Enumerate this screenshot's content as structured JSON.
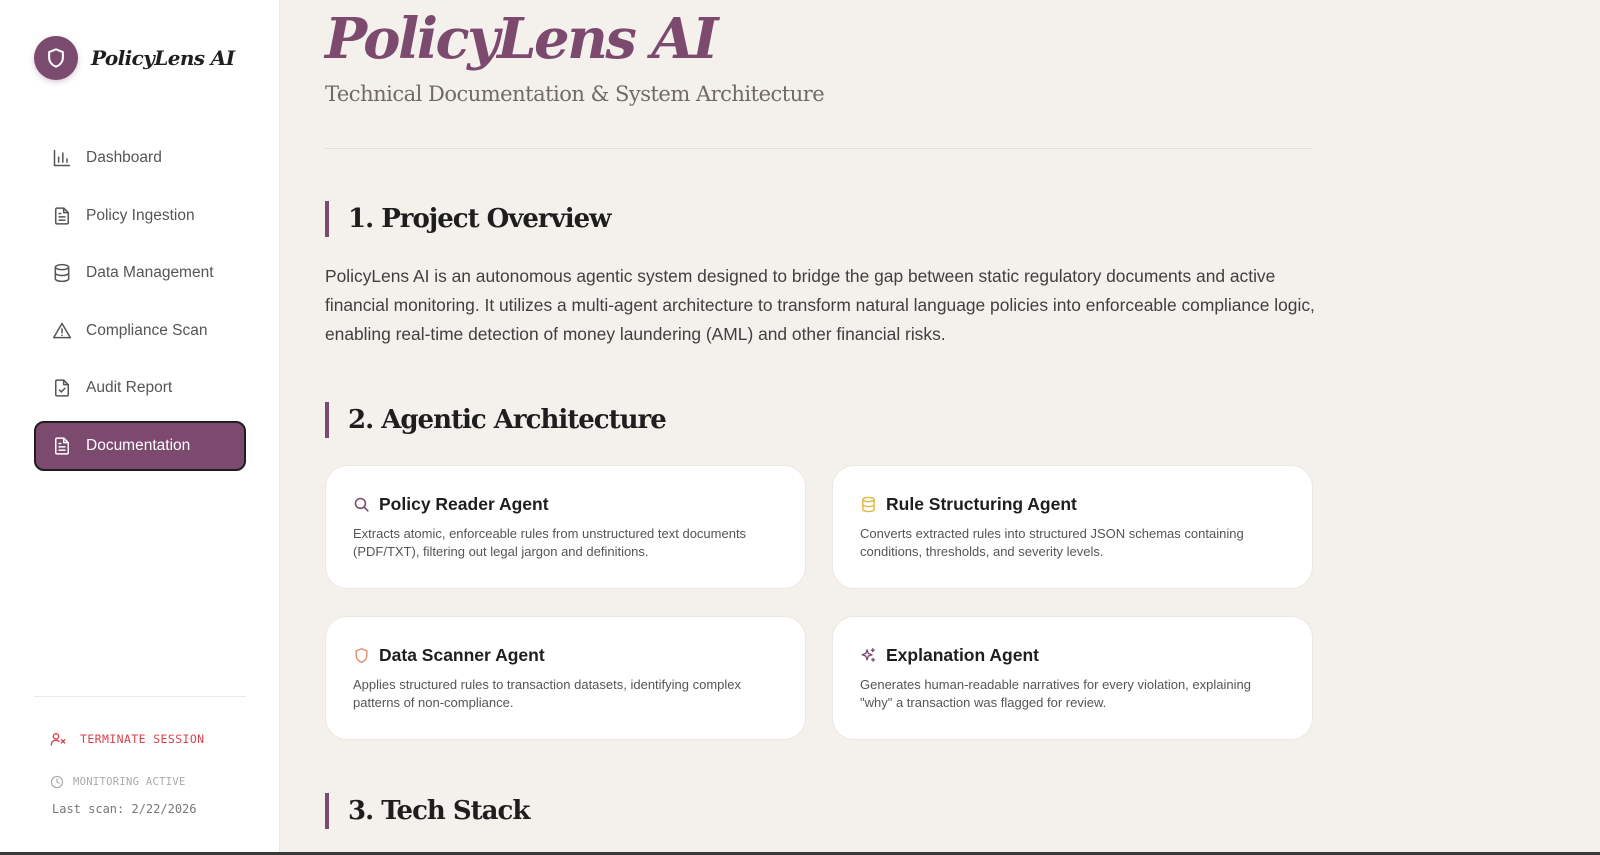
{
  "app": {
    "name": "PolicyLens AI"
  },
  "sidebar": {
    "items": [
      {
        "label": "Dashboard",
        "icon": "bar-chart-icon"
      },
      {
        "label": "Policy Ingestion",
        "icon": "file-text-icon"
      },
      {
        "label": "Data Management",
        "icon": "database-icon"
      },
      {
        "label": "Compliance Scan",
        "icon": "alert-triangle-icon"
      },
      {
        "label": "Audit Report",
        "icon": "file-check-icon"
      },
      {
        "label": "Documentation",
        "icon": "file-text-icon",
        "active": true
      }
    ],
    "terminate_label": "TERMINATE SESSION",
    "monitoring_label": "MONITORING ACTIVE",
    "last_scan": "Last scan: 2/22/2026"
  },
  "header": {
    "title": "PolicyLens AI",
    "subtitle": "Technical Documentation & System Architecture"
  },
  "sections": {
    "overview": {
      "title": "1. Project Overview",
      "body": "PolicyLens AI is an autonomous agentic system designed to bridge the gap between static regulatory documents and active financial monitoring. It utilizes a multi-agent architecture to transform natural language policies into enforceable compliance logic, enabling real-time detection of money laundering (AML) and other financial risks."
    },
    "architecture": {
      "title": "2. Agentic Architecture",
      "agents": [
        {
          "title": "Policy Reader Agent",
          "icon": "search-icon",
          "desc": "Extracts atomic, enforceable rules from unstructured text documents (PDF/TXT), filtering out legal jargon and definitions."
        },
        {
          "title": "Rule Structuring Agent",
          "icon": "database-icon",
          "desc": "Converts extracted rules into structured JSON schemas containing conditions, thresholds, and severity levels."
        },
        {
          "title": "Data Scanner Agent",
          "icon": "shield-icon",
          "desc": "Applies structured rules to transaction datasets, identifying complex patterns of non-compliance."
        },
        {
          "title": "Explanation Agent",
          "icon": "sparkles-icon",
          "desc": "Generates human-readable narratives for every violation, explaining \"why\" a transaction was flagged for review."
        }
      ]
    },
    "tech": {
      "title": "3. Tech Stack"
    }
  },
  "colors": {
    "accent": "#7d4a6f",
    "background": "#f4f1ed",
    "danger": "#d6424f",
    "agent_icon_reader": "#7d4a6f",
    "agent_icon_structuring": "#e0b84a",
    "agent_icon_scanner": "#e08c6a",
    "agent_icon_explanation": "#7d4a6f"
  }
}
